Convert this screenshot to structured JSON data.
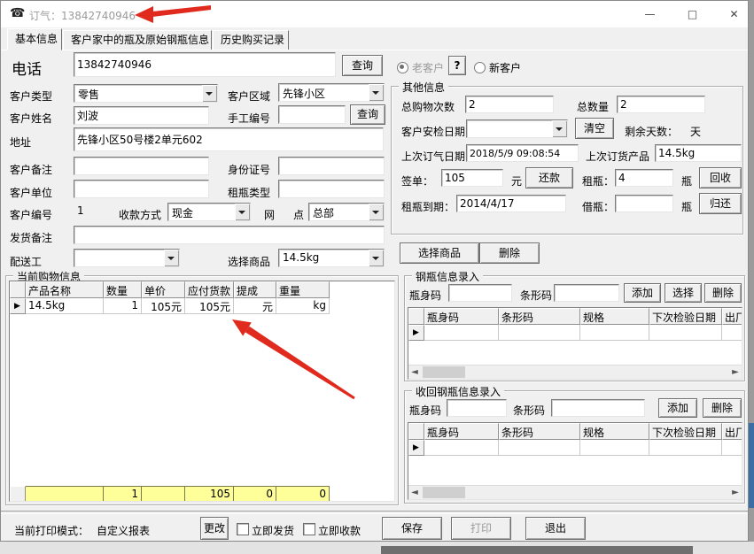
{
  "window": {
    "title": "订气：13842740946",
    "minimize_glyph": "—",
    "maximize_glyph": "□",
    "close_glyph": "✕",
    "phone_icon_glyph": "☎"
  },
  "tabs": [
    {
      "label": "基本信息"
    },
    {
      "label": "客户家中的瓶及原始钢瓶信息"
    },
    {
      "label": "历史购买记录"
    }
  ],
  "left_form": {
    "phone_label": "电话",
    "phone_value": "13842740946",
    "phone_query_button": "查询",
    "customer_type_label": "客户类型",
    "customer_type_value": "零售",
    "customer_area_label": "客户区域",
    "customer_area_value": "先锋小区",
    "customer_name_label": "客户姓名",
    "customer_name_value": "刘波",
    "manual_no_label": "手工编号",
    "manual_no_value": "",
    "manual_query_button": "查询",
    "address_label": "地址",
    "address_value": "先锋小区50号楼2单元602",
    "customer_note_label": "客户备注",
    "customer_note_value": "",
    "id_number_label": "身份证号",
    "id_number_value": "",
    "customer_unit_label": "客户单位",
    "customer_unit_value": "",
    "rent_type_label": "租瓶类型",
    "rent_type_value": "",
    "customer_no_label": "客户编号",
    "customer_no_value": "1",
    "payment_label": "收款方式",
    "payment_value": "现金",
    "branch_label_a": "网",
    "branch_label_b": "点",
    "branch_value": "总部",
    "ship_note_label": "发货备注",
    "ship_note_value": "",
    "delivery_label": "配送工",
    "delivery_value": "",
    "select_product_label": "选择商品",
    "select_product_value": "14.5kg"
  },
  "customer_status": {
    "old_label": "老客户",
    "help_button": "?",
    "new_label": "新客户"
  },
  "other_info": {
    "group_title": "其他信息",
    "total_purchases_label": "总购物次数",
    "total_purchases_value": "2",
    "total_qty_label": "总数量",
    "total_qty_value": "2",
    "safety_date_label": "客户安检日期",
    "safety_date_value": "",
    "clear_button": "清空",
    "days_left_label": "剩余天数：",
    "days_left_unit": "天",
    "last_order_date_label": "上次订气日期",
    "last_order_date_value": "2018/5/9 09:08:54",
    "last_product_label": "上次订货产品",
    "last_product_value": "14.5kg",
    "sign_label": "签单：",
    "sign_value": "105",
    "yuan_unit": "元",
    "repay_button": "还款",
    "rent_label": "租瓶：",
    "rent_value": "4",
    "bottle_unit_1": "瓶",
    "recycle_button": "回收",
    "rent_due_label": "租瓶到期：",
    "rent_due_value": "2014/4/17",
    "borrow_label": "借瓶：",
    "borrow_value": "",
    "bottle_unit_2": "瓶",
    "return_button": "归还",
    "choose_product_button": "选择商品",
    "delete_button": "删除"
  },
  "purchase_info": {
    "group_title": "当前购物信息",
    "headers": [
      "产品名称",
      "数量",
      "单价",
      "应付货款",
      "提成",
      "重量"
    ],
    "row": [
      "14.5kg",
      "1",
      "105元",
      "105元",
      "元",
      "kg"
    ],
    "totals": [
      "",
      "1",
      "",
      "105",
      "0",
      "0"
    ],
    "row_marker": "▶"
  },
  "cylinder_entry": {
    "group_title": "钢瓶信息录入",
    "bottle_code_label": "瓶身码",
    "bottle_code_value": "",
    "barcode_label": "条形码",
    "barcode_value": "",
    "add_button": "添加",
    "select_button": "选择",
    "delete_button": "删除",
    "headers": [
      "瓶身码",
      "条形码",
      "规格",
      "下次检验日期",
      "出厂"
    ],
    "row_marker": "▶"
  },
  "recovered_entry": {
    "group_title": "收回钢瓶信息录入",
    "bottle_code_label": "瓶身码",
    "bottle_code_value": "",
    "barcode_label": "条形码",
    "barcode_value": "",
    "add_button": "添加",
    "delete_button": "删除",
    "headers": [
      "瓶身码",
      "条形码",
      "规格",
      "下次检验日期",
      "出厂"
    ],
    "row_marker": "▶"
  },
  "bottom_bar": {
    "print_mode_label": "当前打印模式：",
    "print_mode_value": "自定义报表",
    "change_button": "更改",
    "ship_now_label": "立即发货",
    "collect_now_label": "立即收款",
    "save_button": "保存",
    "print_button": "打印",
    "exit_button": "退出"
  },
  "scrollbar": {
    "left_glyph": "◄",
    "right_glyph": "►"
  },
  "colors": {
    "highlight_row": "#ffff99",
    "annotation_arrow": "#e02a1e",
    "title_text": "#9b9b9b"
  }
}
